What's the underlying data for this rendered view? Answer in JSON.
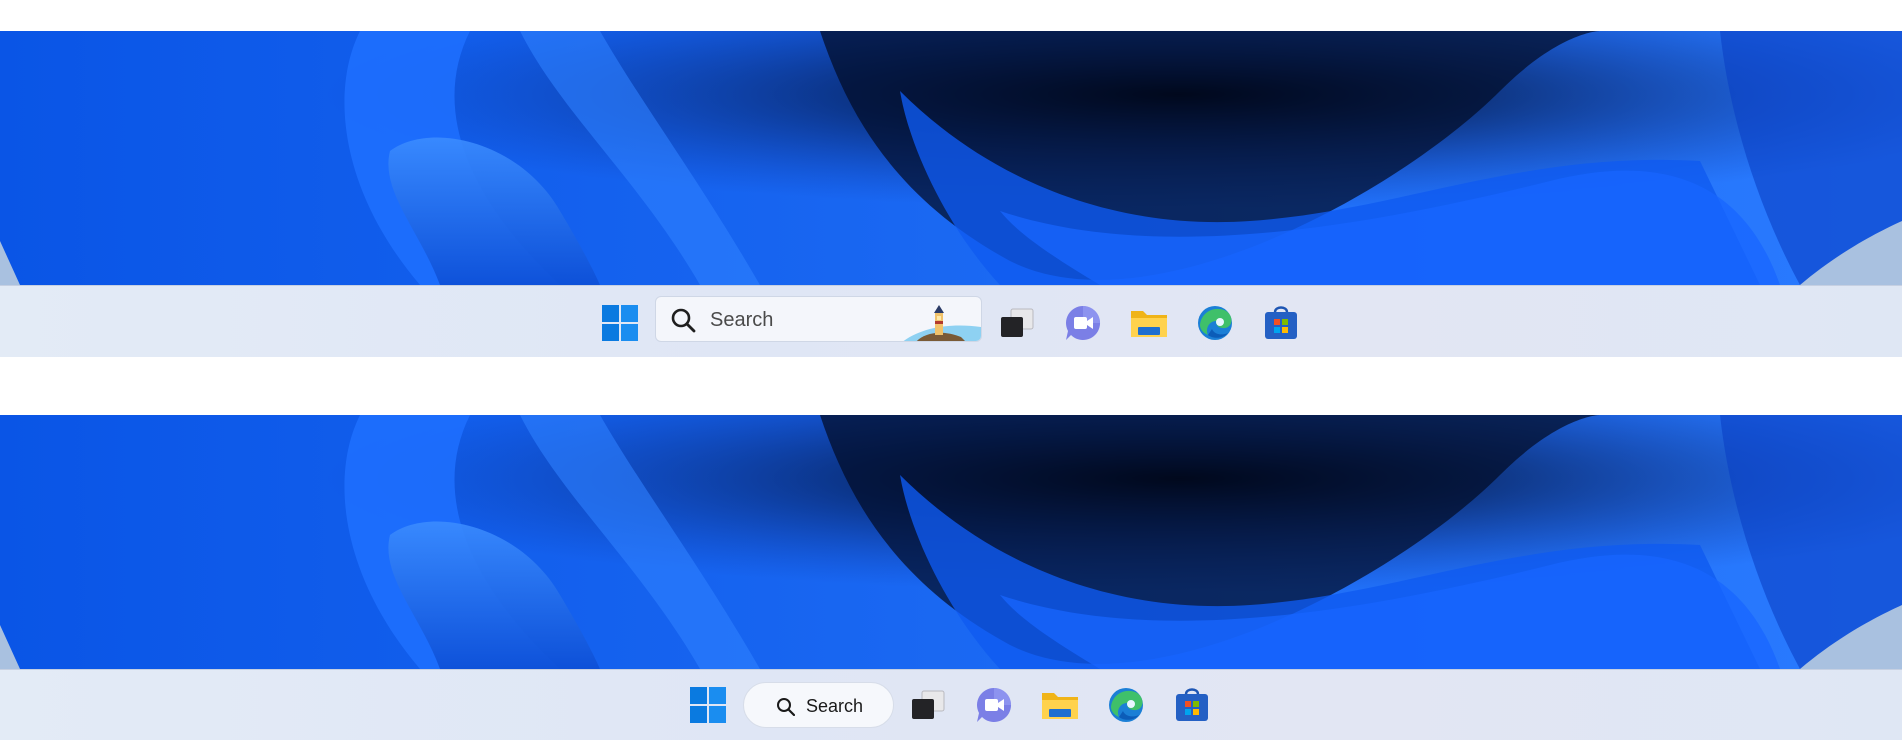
{
  "taskbar_top": {
    "search": {
      "placeholder": "Search",
      "style": "wide-box-with-highlight"
    },
    "icons": [
      "windows-start-icon",
      "search-icon",
      "task-view-icon",
      "teams-chat-icon",
      "file-explorer-icon",
      "edge-browser-icon",
      "microsoft-store-icon"
    ]
  },
  "taskbar_bottom": {
    "search": {
      "placeholder": "Search",
      "style": "pill"
    },
    "icons": [
      "windows-start-icon",
      "search-icon",
      "task-view-icon",
      "teams-chat-icon",
      "file-explorer-icon",
      "edge-browser-icon",
      "microsoft-store-icon"
    ]
  },
  "colors": {
    "wallpaper_blue": "#1b6cff",
    "wallpaper_dark": "#03102f",
    "taskbar_bg": "#e1e8f5",
    "windows_blue": "#0078d4",
    "teams_purple": "#6264a7",
    "explorer_yellow": "#f5c02d",
    "store_blue": "#2460c4"
  }
}
